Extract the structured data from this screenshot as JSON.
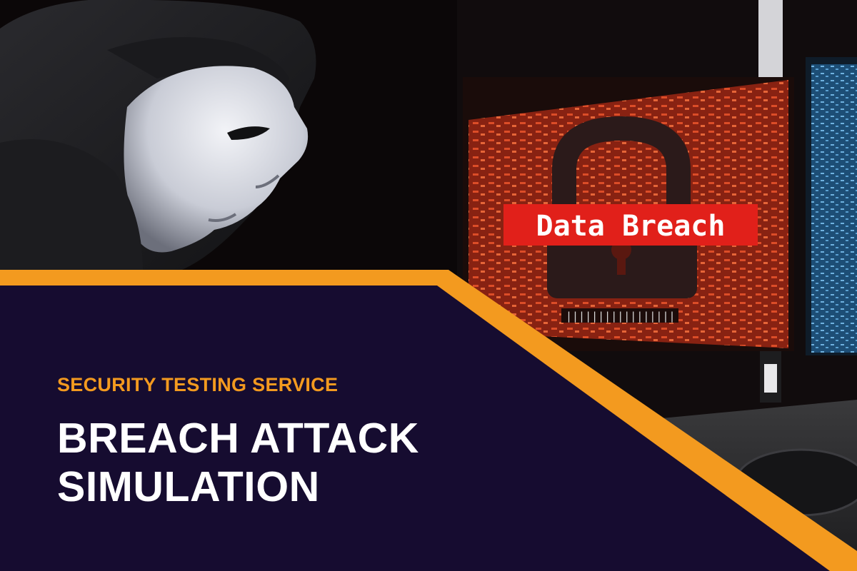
{
  "hero": {
    "eyebrow": "SECURITY TESTING SERVICE",
    "headline_line1": "BREACH ATTACK",
    "headline_line2": "SIMULATION"
  },
  "photo": {
    "screen_banner": "Data Breach",
    "screen_progress": "|||||||||||||||||"
  },
  "theme": {
    "accent": "#f39a1f",
    "panel": "#160c30",
    "text": "#ffffff",
    "screen_red": "#b9301a",
    "screen_blue": "#2d6f9e"
  }
}
